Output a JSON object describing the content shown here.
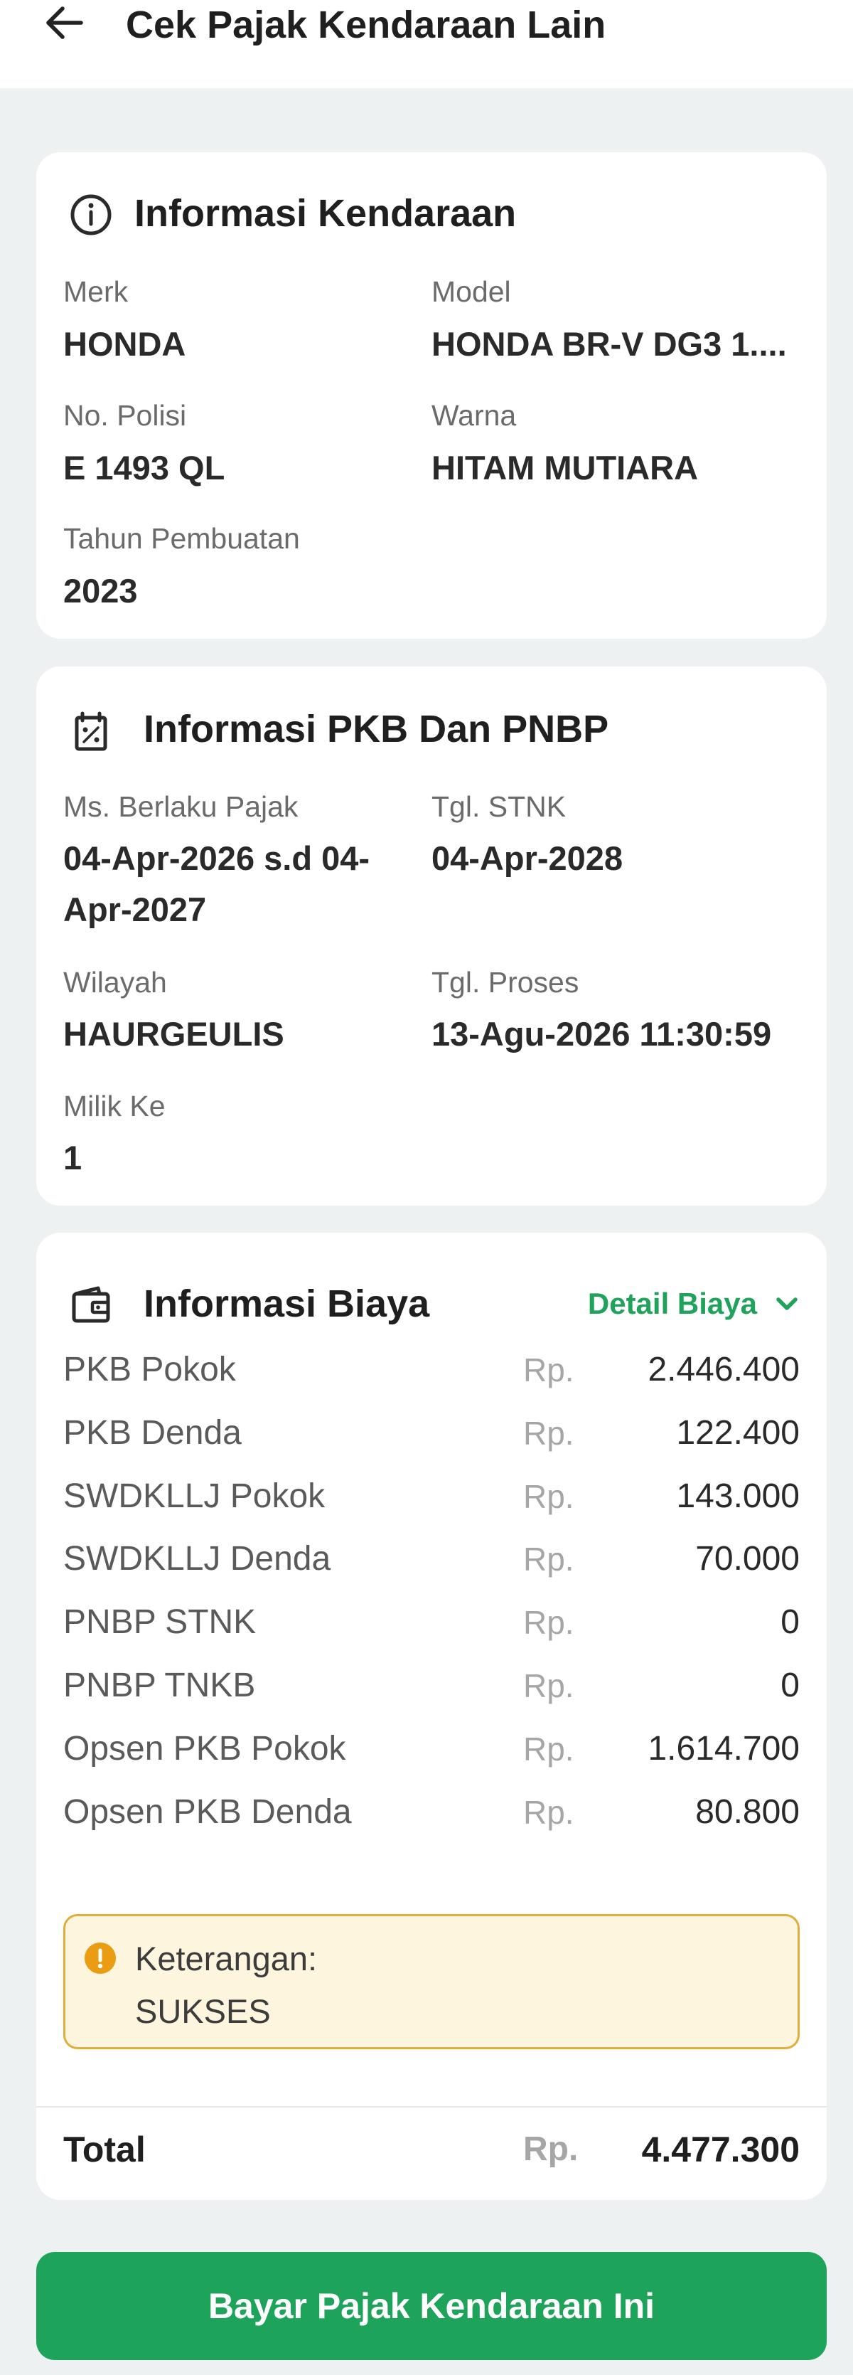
{
  "header": {
    "title": "Cek Pajak Kendaraan Lain"
  },
  "vehicle_info": {
    "title": "Informasi Kendaraan",
    "fields": [
      {
        "label": "Merk",
        "value": "HONDA"
      },
      {
        "label": "Model",
        "value": "HONDA BR-V DG3 1...."
      },
      {
        "label": "No. Polisi",
        "value": "E 1493 QL"
      },
      {
        "label": "Warna",
        "value": "HITAM MUTIARA"
      },
      {
        "label": "Tahun Pembuatan",
        "value": "2023"
      }
    ]
  },
  "pkb_info": {
    "title": "Informasi PKB Dan PNBP",
    "fields": [
      {
        "label": "Ms. Berlaku Pajak",
        "value": "04-Apr-2026 s.d 04-Apr-2027"
      },
      {
        "label": "Tgl. STNK",
        "value": "04-Apr-2028"
      },
      {
        "label": "Wilayah",
        "value": "HAURGEULIS"
      },
      {
        "label": "Tgl. Proses",
        "value": "13-Agu-2026 11:30:59"
      },
      {
        "label": "Milik Ke",
        "value": "1"
      }
    ]
  },
  "cost_info": {
    "title": "Informasi Biaya",
    "detail_link": "Detail Biaya",
    "currency": "Rp.",
    "rows": [
      {
        "label": "PKB Pokok",
        "value": "2.446.400"
      },
      {
        "label": "PKB Denda",
        "value": "122.400"
      },
      {
        "label": "SWDKLLJ Pokok",
        "value": "143.000"
      },
      {
        "label": "SWDKLLJ Denda",
        "value": "70.000"
      },
      {
        "label": "PNBP STNK",
        "value": "0"
      },
      {
        "label": "PNBP TNKB",
        "value": "0"
      },
      {
        "label": "Opsen PKB Pokok",
        "value": "1.614.700"
      },
      {
        "label": "Opsen PKB Denda",
        "value": "80.800"
      }
    ],
    "note": {
      "title": "Keterangan:",
      "status": "SUKSES"
    },
    "total": {
      "label": "Total",
      "value": "4.477.300"
    }
  },
  "pay_button": {
    "label": "Bayar Pajak Kendaraan Ini"
  },
  "colors": {
    "accent_green": "#1ea35a",
    "note_border": "#e0ae3a",
    "note_background": "#fdf5dd",
    "page_background": "#eef1f1"
  },
  "icons": {
    "back": "arrow-left-icon",
    "vehicle_info": "info-circle-icon",
    "pkb_info": "calendar-percent-icon",
    "cost_info": "wallet-icon",
    "detail": "chevron-down-icon",
    "note": "info-filled-icon"
  }
}
